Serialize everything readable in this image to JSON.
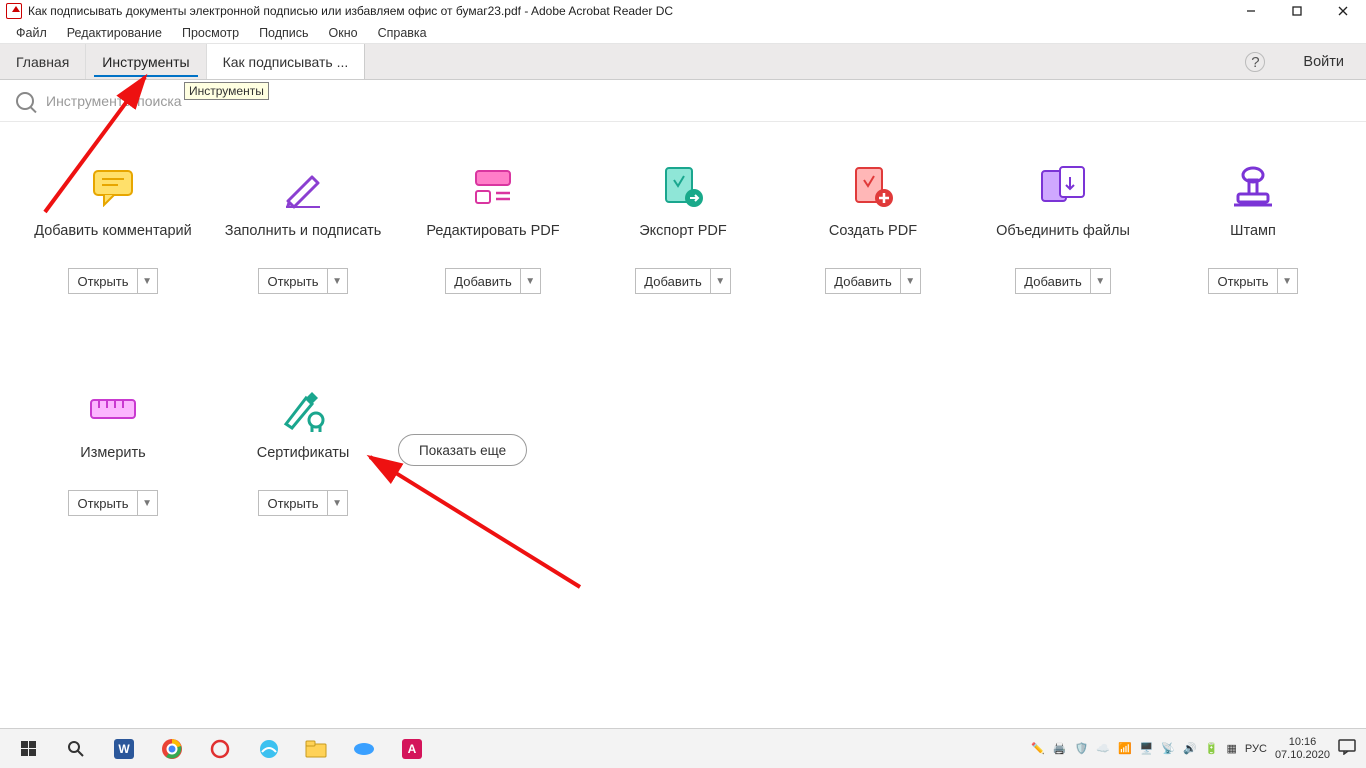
{
  "window": {
    "title": "Как подписывать документы электронной подписью или избавляем офис от бумаг23.pdf - Adobe Acrobat Reader DC"
  },
  "menubar": {
    "file": "Файл",
    "edit": "Редактирование",
    "view": "Просмотр",
    "sign": "Подпись",
    "window": "Окно",
    "help": "Справка"
  },
  "tabs": {
    "home": "Главная",
    "tools": "Инструменты",
    "doc": "Как подписывать ..."
  },
  "tooltip": "Инструменты",
  "login": "Войти",
  "search_placeholder": "Инструменты поиска",
  "action_open": "Открыть",
  "action_add": "Добавить",
  "tools_list": {
    "comment": "Добавить комментарий",
    "fill_sign": "Заполнить и подписать",
    "edit_pdf": "Редактировать PDF",
    "export": "Экспорт PDF",
    "create": "Создать PDF",
    "combine": "Объединить файлы",
    "stamp": "Штамп",
    "measure": "Измерить",
    "cert": "Сертификаты"
  },
  "show_more": "Показать еще",
  "tray": {
    "lang": "РУС",
    "time": "10:16",
    "date": "07.10.2020"
  }
}
